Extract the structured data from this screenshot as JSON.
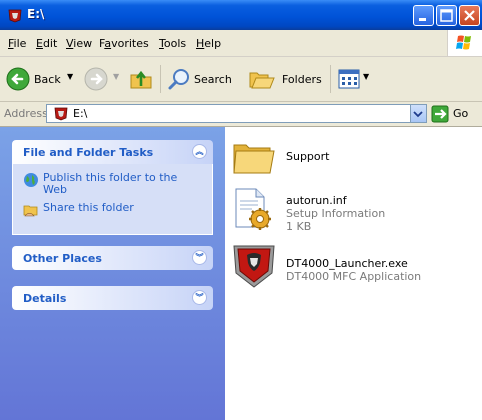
{
  "window": {
    "title": "E:\\"
  },
  "menu": {
    "items": [
      {
        "label": "File",
        "key": "F",
        "rest": "ile"
      },
      {
        "label": "Edit",
        "key": "E",
        "rest": "dit"
      },
      {
        "label": "View",
        "key": "V",
        "rest": "iew"
      },
      {
        "label": "Favorites",
        "key": "a",
        "pre": "F",
        "rest": "vorites"
      },
      {
        "label": "Tools",
        "key": "T",
        "rest": "ools"
      },
      {
        "label": "Help",
        "key": "H",
        "rest": "elp"
      }
    ]
  },
  "toolbar": {
    "back_label": "Back",
    "search_label": "Search",
    "folders_label": "Folders"
  },
  "address": {
    "label": "Address",
    "value": "E:\\",
    "go_label": "Go"
  },
  "sidebar": {
    "tasks_title": "File and Folder Tasks",
    "tasks": [
      {
        "label": "Publish this folder to the Web"
      },
      {
        "label": "Share this folder"
      }
    ],
    "other_places_title": "Other Places",
    "details_title": "Details"
  },
  "files": [
    {
      "name": "Support",
      "type": "",
      "size": ""
    },
    {
      "name": "autorun.inf",
      "type": "Setup Information",
      "size": "1 KB"
    },
    {
      "name": "DT4000_Launcher.exe",
      "type": "DT4000 MFC Application",
      "size": ""
    }
  ],
  "colors": {
    "title_bar": "#0053d8",
    "task_pane": "#7ba2e7",
    "link": "#215dc6",
    "toolbar": "#ece9d8"
  },
  "icons": {
    "drive": "kingston-drive-icon",
    "folder": "folder-icon",
    "inf": "setup-info-icon",
    "exe": "kingston-shield-icon"
  }
}
